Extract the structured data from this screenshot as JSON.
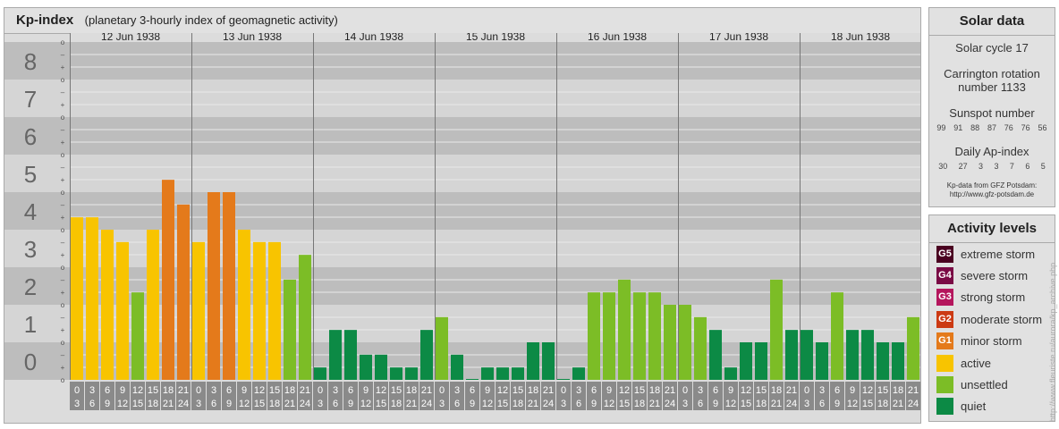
{
  "header": {
    "title": "Kp-index",
    "subtitle": "(planetary 3-hourly index of geomagnetic activity)"
  },
  "solar": {
    "title": "Solar data",
    "cycle": "Solar cycle 17",
    "carrington_line1": "Carrington rotation",
    "carrington_line2": "number 1133",
    "sunspot_title": "Sunspot number",
    "sunspot_values": [
      "99",
      "91",
      "88",
      "87",
      "76",
      "76",
      "56"
    ],
    "ap_title": "Daily Ap-index",
    "ap_values": [
      "30",
      "27",
      "3",
      "3",
      "7",
      "6",
      "5"
    ],
    "credit_line1": "Kp-data from GFZ Potsdam:",
    "credit_line2": "http://www.gfz-potsdam.de"
  },
  "levels": {
    "title": "Activity levels",
    "items": [
      {
        "badge": "G5",
        "label": "extreme storm",
        "color": "#4a0020"
      },
      {
        "badge": "G4",
        "label": "severe storm",
        "color": "#7a0a45"
      },
      {
        "badge": "G3",
        "label": "strong storm",
        "color": "#b5165d"
      },
      {
        "badge": "G2",
        "label": "moderate storm",
        "color": "#cc3a13"
      },
      {
        "badge": "G1",
        "label": "minor storm",
        "color": "#e47a1b"
      },
      {
        "badge": "",
        "label": "active",
        "color": "#f8c400"
      },
      {
        "badge": "",
        "label": "unsettled",
        "color": "#7cbd26"
      },
      {
        "badge": "",
        "label": "quiet",
        "color": "#0c8a45"
      }
    ]
  },
  "side_url": "http://www.fleuriste.ru/aurora/kp_archive.php",
  "chart_data": {
    "type": "bar",
    "ylim": [
      0,
      9
    ],
    "y_ticks": [
      "0",
      "1",
      "2",
      "3",
      "4",
      "5",
      "6",
      "7",
      "8",
      "9"
    ],
    "y_subticks": [
      "o",
      "+",
      "–"
    ],
    "days": [
      "12 Jun 1938",
      "13 Jun 1938",
      "14 Jun 1938",
      "15 Jun 1938",
      "16 Jun 1938",
      "17 Jun 1938",
      "18 Jun 1938"
    ],
    "interval_labels": [
      [
        "0",
        "3"
      ],
      [
        "3",
        "6"
      ],
      [
        "6",
        "9"
      ],
      [
        "9",
        "12"
      ],
      [
        "12",
        "15"
      ],
      [
        "15",
        "18"
      ],
      [
        "18",
        "21"
      ],
      [
        "21",
        "24"
      ]
    ],
    "values": [
      [
        4.33,
        4.33,
        4.0,
        3.67,
        2.33,
        4.0,
        5.33,
        4.67
      ],
      [
        3.67,
        5.0,
        5.0,
        4.0,
        3.67,
        3.67,
        2.67,
        3.33
      ],
      [
        0.33,
        1.33,
        1.33,
        0.67,
        0.67,
        0.33,
        0.33,
        1.33
      ],
      [
        1.67,
        0.67,
        0.0,
        0.33,
        0.33,
        0.33,
        1.0,
        1.0
      ],
      [
        0.0,
        0.33,
        2.33,
        2.33,
        2.67,
        2.33,
        2.33,
        2.0
      ],
      [
        2.0,
        1.67,
        1.33,
        0.33,
        1.0,
        1.0,
        2.67,
        1.33
      ],
      [
        1.33,
        1.0,
        2.33,
        1.33,
        1.33,
        1.0,
        1.0,
        1.67
      ]
    ],
    "colors": {
      "quiet": "#0c8a45",
      "unsettled": "#7cbd26",
      "active": "#f8c400",
      "minor_storm": "#e47a1b"
    }
  }
}
